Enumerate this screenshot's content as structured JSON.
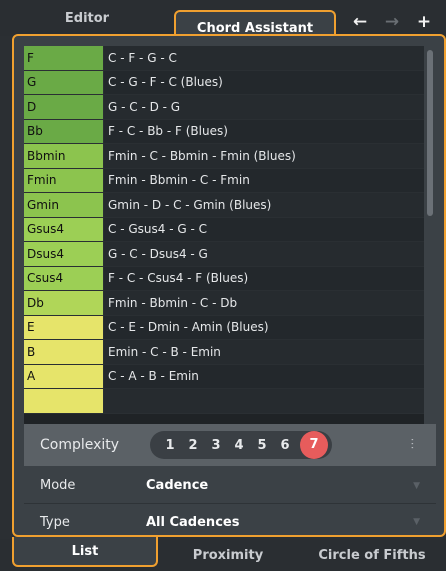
{
  "tabs": {
    "editor": "Editor",
    "chord_assistant": "Chord Assistant"
  },
  "nav": {
    "back_icon": "arrow-left-icon",
    "forward_icon": "arrow-right-icon",
    "add_icon": "plus-icon"
  },
  "rows": [
    {
      "key": "F",
      "progression": "C - F - G - C",
      "color": "#6aaa46"
    },
    {
      "key": "G",
      "progression": "C - G - F - C (Blues)",
      "color": "#6aaa46"
    },
    {
      "key": "D",
      "progression": "G - C - D - G",
      "color": "#6aaa46"
    },
    {
      "key": "Bb",
      "progression": "F - C - Bb - F (Blues)",
      "color": "#6aaa46"
    },
    {
      "key": "Bbmin",
      "progression": "Fmin - C - Bbmin - Fmin (Blues)",
      "color": "#8cc44e"
    },
    {
      "key": "Fmin",
      "progression": "Fmin - Bbmin - C - Fmin",
      "color": "#8cc44e"
    },
    {
      "key": "Gmin",
      "progression": "Gmin - D - C - Gmin (Blues)",
      "color": "#8cc44e"
    },
    {
      "key": "Gsus4",
      "progression": "C - Gsus4 - G - C",
      "color": "#9ccf55"
    },
    {
      "key": "Dsus4",
      "progression": "G - C - Dsus4 - G",
      "color": "#9ccf55"
    },
    {
      "key": "Csus4",
      "progression": "F - C - Csus4 - F (Blues)",
      "color": "#9ccf55"
    },
    {
      "key": "Db",
      "progression": "Fmin - Bbmin - C - Db",
      "color": "#b0d658"
    },
    {
      "key": "E",
      "progression": "C - E - Dmin - Amin (Blues)",
      "color": "#e6e46a"
    },
    {
      "key": "B",
      "progression": "Emin - C - B - Emin",
      "color": "#e6e46a"
    },
    {
      "key": "A",
      "progression": "C - A - B - Emin",
      "color": "#e6e46a"
    },
    {
      "key": "",
      "progression": "",
      "color": "#e6e46a"
    }
  ],
  "complexity": {
    "label": "Complexity",
    "steps": [
      "1",
      "2",
      "3",
      "4",
      "5",
      "6",
      "7"
    ],
    "selected": "7"
  },
  "mode": {
    "label": "Mode",
    "value": "Cadence"
  },
  "type": {
    "label": "Type",
    "value": "All Cadences"
  },
  "bottom_tabs": {
    "list": "List",
    "proximity": "Proximity",
    "circle": "Circle of Fifths"
  }
}
